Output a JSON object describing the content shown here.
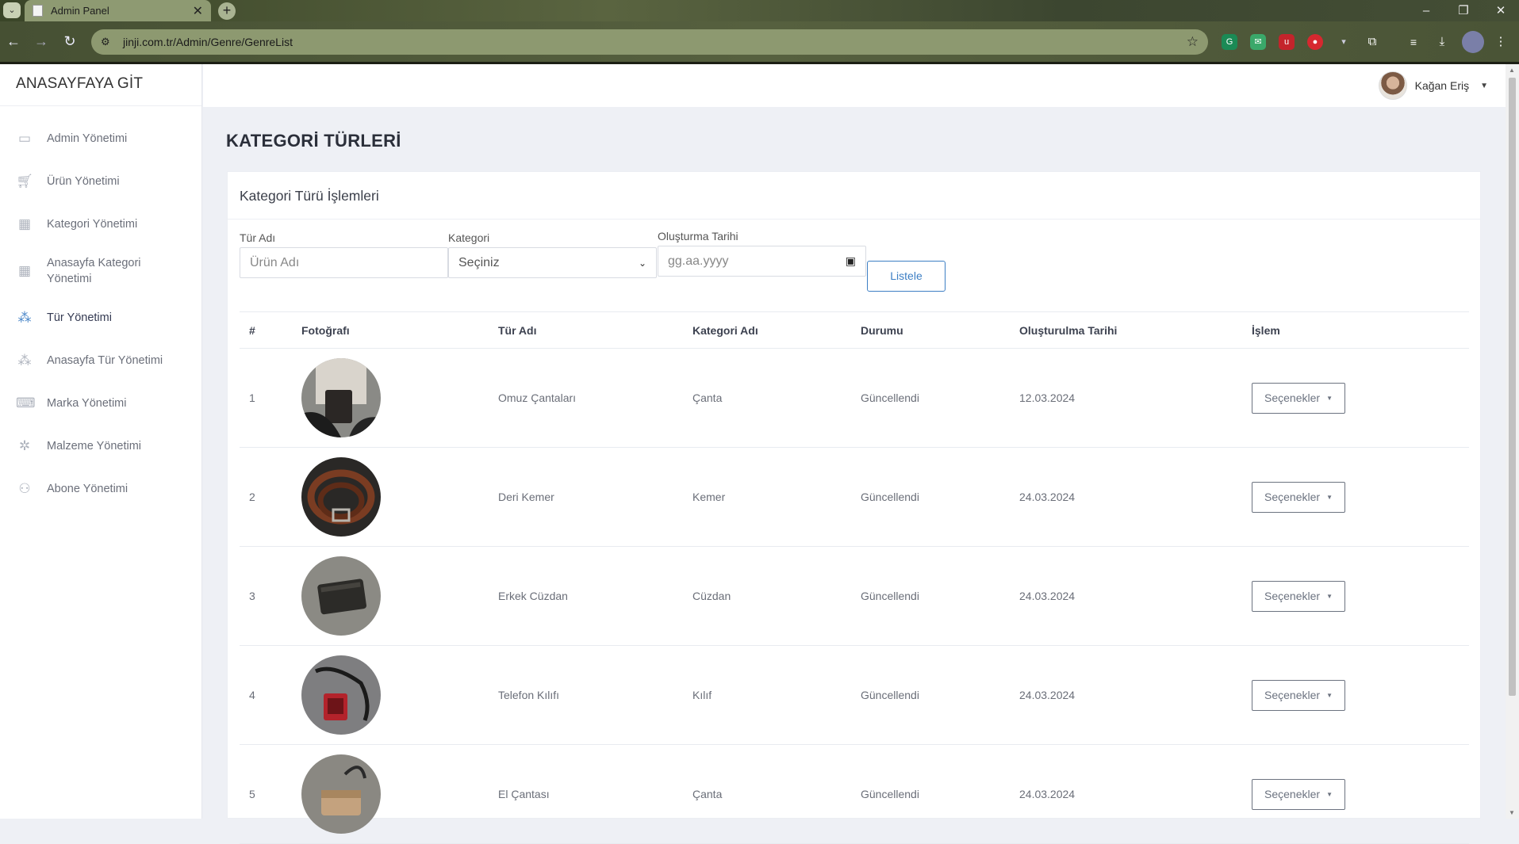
{
  "browser": {
    "tab_title": "Admin Panel",
    "tab_close": "✕",
    "new_tab": "+",
    "url": "jinji.com.tr/Admin/Genre/GenreList",
    "window_controls": [
      "–",
      "❐",
      "✕"
    ]
  },
  "sidebar": {
    "brand": "ANASAYFAYA GİT",
    "items": [
      {
        "label": "Admin Yönetimi",
        "icon": "briefcase-icon",
        "active": false
      },
      {
        "label": "Ürün Yönetimi",
        "icon": "cart-icon",
        "active": false
      },
      {
        "label": "Kategori Yönetimi",
        "icon": "grid-icon",
        "active": false
      },
      {
        "label": "Anasayfa Kategori Yönetimi",
        "icon": "grid-icon",
        "active": false
      },
      {
        "label": "Tür Yönetimi",
        "icon": "hierarchy-icon",
        "active": true
      },
      {
        "label": "Anasayfa Tür Yönetimi",
        "icon": "hierarchy-icon",
        "active": false
      },
      {
        "label": "Marka Yönetimi",
        "icon": "keyboard-icon",
        "active": false
      },
      {
        "label": "Malzeme Yönetimi",
        "icon": "gear-icon",
        "active": false
      },
      {
        "label": "Abone Yönetimi",
        "icon": "users-icon",
        "active": false
      }
    ]
  },
  "header": {
    "user_name": "Kağan Eriş"
  },
  "page": {
    "title": "KATEGORİ TÜRLERİ",
    "card_title": "Kategori Türü İşlemleri"
  },
  "filters": {
    "name_label": "Tür Adı",
    "name_placeholder": "Ürün Adı",
    "category_label": "Kategori",
    "category_selected": "Seçiniz",
    "date_label": "Oluşturma Tarihi",
    "date_placeholder": "gg.aa.yyyy",
    "list_button": "Listele"
  },
  "table": {
    "headers": [
      "#",
      "Fotoğrafı",
      "Tür Adı",
      "Kategori Adı",
      "Durumu",
      "Oluşturulma Tarihi",
      "İşlem"
    ],
    "rows": [
      {
        "no": "1",
        "name": "Omuz Çantaları",
        "category": "Çanta",
        "status": "Güncellendi",
        "date": "12.03.2024",
        "action": "Seçenekler"
      },
      {
        "no": "2",
        "name": "Deri Kemer",
        "category": "Kemer",
        "status": "Güncellendi",
        "date": "24.03.2024",
        "action": "Seçenekler"
      },
      {
        "no": "3",
        "name": "Erkek Cüzdan",
        "category": "Cüzdan",
        "status": "Güncellendi",
        "date": "24.03.2024",
        "action": "Seçenekler"
      },
      {
        "no": "4",
        "name": "Telefon Kılıfı",
        "category": "Kılıf",
        "status": "Güncellendi",
        "date": "24.03.2024",
        "action": "Seçenekler"
      },
      {
        "no": "5",
        "name": "El Çantası",
        "category": "Çanta",
        "status": "Güncellendi",
        "date": "24.03.2024",
        "action": "Seçenekler"
      }
    ]
  },
  "colors": {
    "accent": "#3d7fc4",
    "active_icon": "#4a86c8"
  }
}
